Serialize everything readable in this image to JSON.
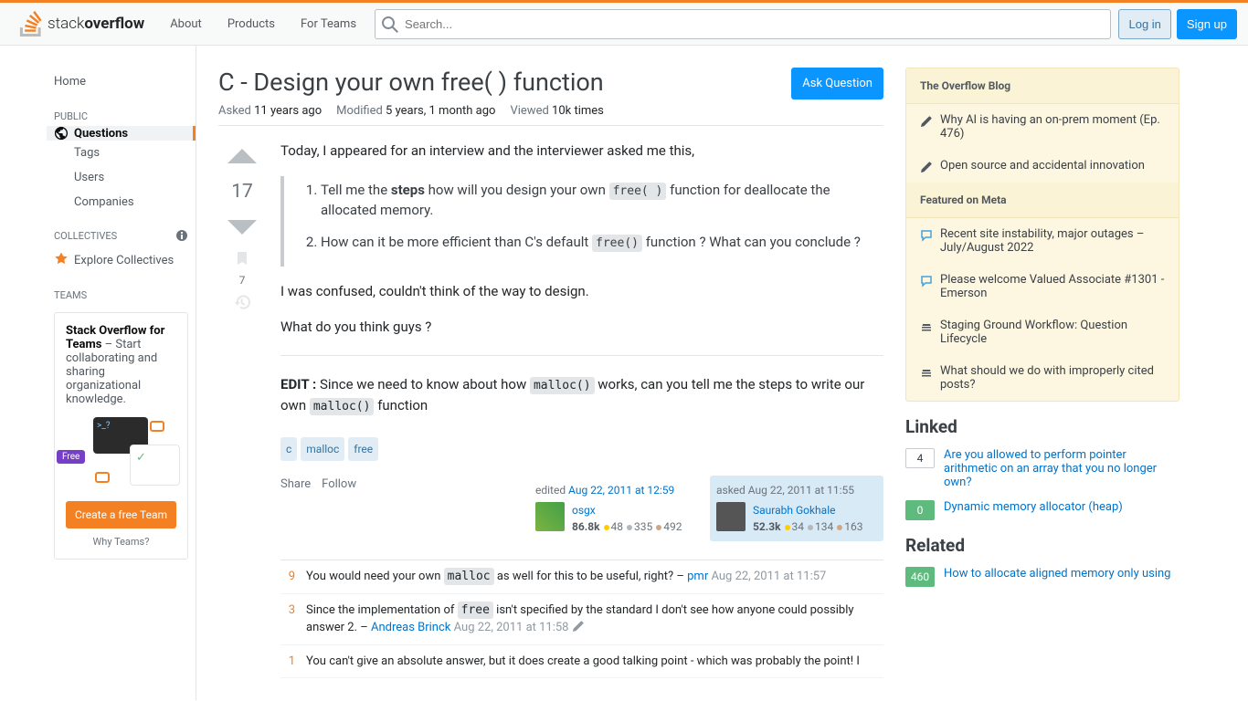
{
  "header": {
    "logo_text_a": "stack",
    "logo_text_b": "overflow",
    "nav": [
      "About",
      "Products",
      "For Teams"
    ],
    "search_placeholder": "Search...",
    "login": "Log in",
    "signup": "Sign up"
  },
  "sidebar": {
    "home": "Home",
    "public_label": "PUBLIC",
    "questions": "Questions",
    "tags": "Tags",
    "users": "Users",
    "companies": "Companies",
    "collectives_label": "COLLECTIVES",
    "explore_collectives": "Explore Collectives",
    "teams_label": "TEAMS",
    "teams_promo_strong": "Stack Overflow for Teams",
    "teams_promo_text": " – Start collaborating and sharing organizational knowledge.",
    "teams_free": "Free",
    "teams_cta": "Create a free Team",
    "teams_why": "Why Teams?"
  },
  "question": {
    "title": "C - Design your own free( ) function",
    "ask_button": "Ask Question",
    "asked_label": "Asked",
    "asked_value": "11 years ago",
    "modified_label": "Modified",
    "modified_value": "5 years, 1 month ago",
    "viewed_label": "Viewed",
    "viewed_value": "10k times",
    "vote_count": "17",
    "bookmark_count": "7",
    "body_p1": "Today, I appeared for an interview and the interviewer asked me this,",
    "quote_li1_a": "Tell me the ",
    "quote_li1_b": "steps",
    "quote_li1_c": " how will you design your own ",
    "quote_li1_code": "free( )",
    "quote_li1_d": " function for deallocate the allocated memory.",
    "quote_li2_a": "How can it be more efficient than C's default ",
    "quote_li2_code": "free()",
    "quote_li2_b": " function ? What can you conclude ?",
    "body_p2": "I was confused, couldn't think of the way to design.",
    "body_p3": "What do you think guys ?",
    "edit_strong": "EDIT :",
    "edit_text_a": " Since we need to know about how ",
    "edit_code1": "malloc()",
    "edit_text_b": " works, can you tell me the steps to write our own ",
    "edit_code2": "malloc()",
    "edit_text_c": " function",
    "tags": [
      "c",
      "malloc",
      "free"
    ],
    "share": "Share",
    "follow": "Follow",
    "editor": {
      "action_prefix": "edited ",
      "time": "Aug 22, 2011 at 12:59",
      "name": "osgx",
      "rep": "86.8k",
      "gold": "48",
      "silver": "335",
      "bronze": "492"
    },
    "asker": {
      "action_prefix": "asked ",
      "time": "Aug 22, 2011 at 11:55",
      "name": "Saurabh Gokhale",
      "rep": "52.3k",
      "gold": "34",
      "silver": "134",
      "bronze": "163"
    },
    "comments": [
      {
        "score": "9",
        "text_a": "You would need your own ",
        "code": "malloc",
        "text_b": " as well for this to be useful, right? – ",
        "user": "pmr",
        "time": "Aug 22, 2011 at 11:57"
      },
      {
        "score": "3",
        "text_a": "Since the implementation of ",
        "code": "free",
        "text_b": " isn't specified by the standard I don't see how anyone could possibly answer 2. – ",
        "user": "Andreas Brinck",
        "time": "Aug 22, 2011 at 11:58",
        "pencil": true
      },
      {
        "score": "1",
        "text_a": "You can't give an absolute answer, but it does create a good talking point - which was probably the point! I",
        "code": "",
        "text_b": "",
        "user": "",
        "time": ""
      }
    ]
  },
  "right": {
    "blog_header": "The Overflow Blog",
    "blog_items": [
      "Why AI is having an on-prem moment (Ep. 476)",
      "Open source and accidental innovation"
    ],
    "meta_header": "Featured on Meta",
    "meta_items": [
      {
        "type": "chat",
        "text": "Recent site instability, major outages – July/August 2022"
      },
      {
        "type": "chat",
        "text": "Please welcome Valued Associate #1301 - Emerson"
      },
      {
        "type": "stack",
        "text": "Staging Ground Workflow: Question Lifecycle"
      },
      {
        "type": "stack",
        "text": "What should we do with improperly cited posts?"
      }
    ],
    "linked_header": "Linked",
    "linked": [
      {
        "score": "4",
        "green": false,
        "text": "Are you allowed to perform pointer arithmetic on an array that you no longer own?"
      },
      {
        "score": "0",
        "green": true,
        "text": "Dynamic memory allocator (heap)"
      }
    ],
    "related_header": "Related",
    "related": [
      {
        "score": "460",
        "green": true,
        "text": "How to allocate aligned memory only using"
      }
    ]
  }
}
